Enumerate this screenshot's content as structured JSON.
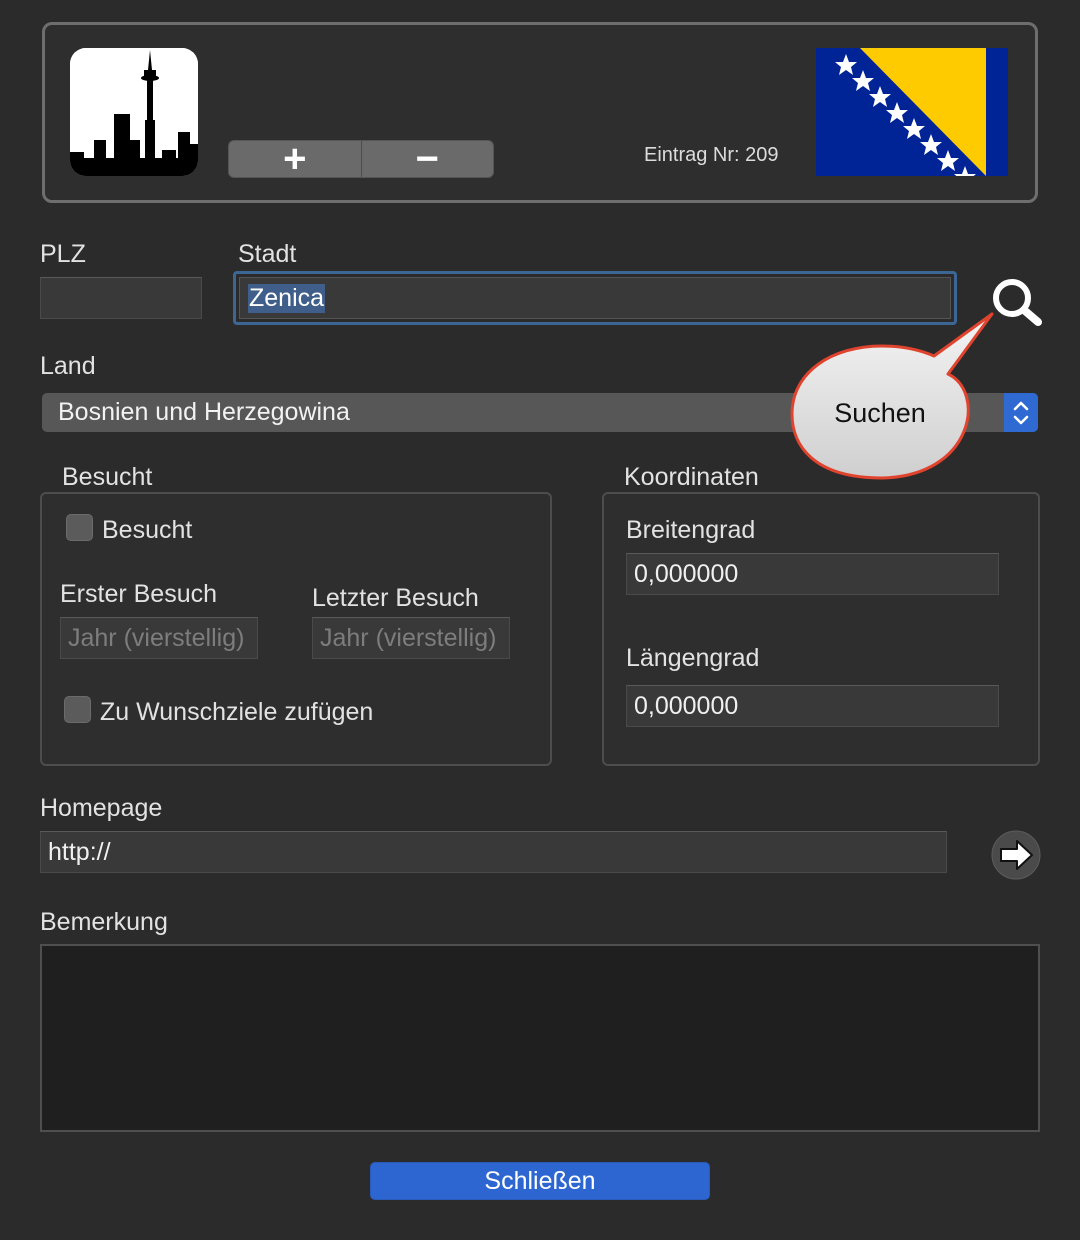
{
  "header": {
    "add_symbol": "+",
    "remove_symbol": "−",
    "entry_label": "Eintrag Nr: 209",
    "flag_colors": {
      "blue": "#002395",
      "yellow": "#FECB00",
      "star": "#ffffff"
    }
  },
  "fields": {
    "plz_label": "PLZ",
    "plz_value": "",
    "stadt_label": "Stadt",
    "stadt_value": "Zenica",
    "land_label": "Land",
    "land_value": "Bosnien und Herzegowina"
  },
  "tooltip": {
    "text": "Suchen"
  },
  "visited": {
    "group_label": "Besucht",
    "checkbox_label": "Besucht",
    "first_visit_label": "Erster Besuch",
    "first_visit_placeholder": "Jahr (vierstellig)",
    "last_visit_label": "Letzter Besuch",
    "last_visit_placeholder": "Jahr (vierstellig)",
    "wishlist_label": "Zu Wunschziele zufügen"
  },
  "coordinates": {
    "group_label": "Koordinaten",
    "lat_label": "Breitengrad",
    "lat_value": "0,000000",
    "lon_label": "Längengrad",
    "lon_value": "0,000000"
  },
  "homepage": {
    "label": "Homepage",
    "value": "http://"
  },
  "remark": {
    "label": "Bemerkung",
    "value": ""
  },
  "close_label": "Schließen",
  "colors": {
    "accent": "#2d66d1",
    "focus_ring": "#3c6795",
    "bubble_stroke": "#e0442e"
  }
}
